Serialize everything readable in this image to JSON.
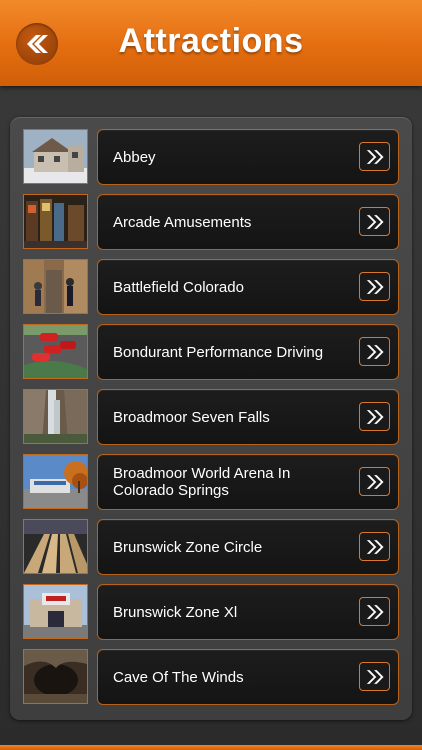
{
  "header": {
    "title": "Attractions",
    "back_icon": "double-chevron-left-icon"
  },
  "colors": {
    "accent": "#e87518",
    "item_border": "#b4611e",
    "background": "#2f2f2f"
  },
  "items": [
    {
      "label": "Abbey",
      "icon": "double-chevron-right-icon"
    },
    {
      "label": "Arcade Amusements",
      "icon": "double-chevron-right-icon"
    },
    {
      "label": "Battlefield Colorado",
      "icon": "double-chevron-right-icon"
    },
    {
      "label": "Bondurant Performance Driving",
      "icon": "double-chevron-right-icon"
    },
    {
      "label": "Broadmoor Seven Falls",
      "icon": "double-chevron-right-icon"
    },
    {
      "label": "Broadmoor World Arena In Colorado Springs",
      "icon": "double-chevron-right-icon"
    },
    {
      "label": "Brunswick Zone Circle",
      "icon": "double-chevron-right-icon"
    },
    {
      "label": "Brunswick Zone Xl",
      "icon": "double-chevron-right-icon"
    },
    {
      "label": "Cave Of The Winds",
      "icon": "double-chevron-right-icon"
    }
  ]
}
